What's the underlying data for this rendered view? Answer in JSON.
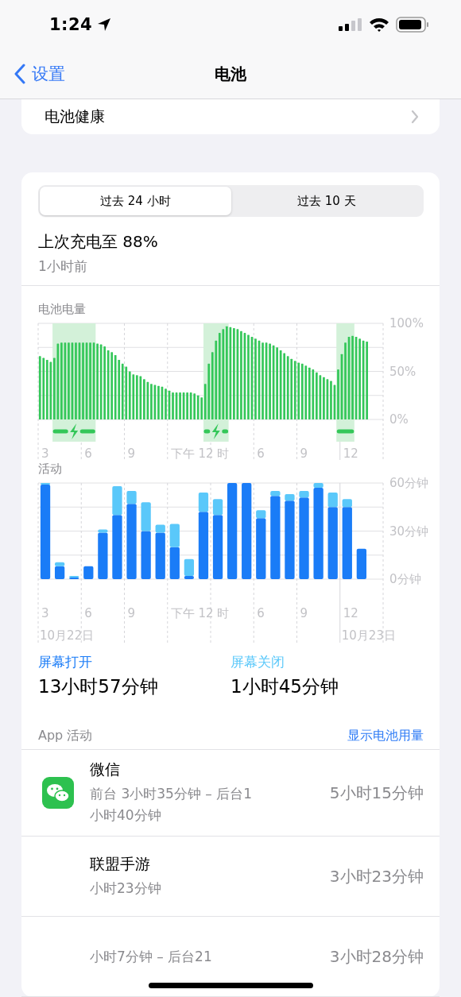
{
  "status_bar": {
    "time": "1:24"
  },
  "nav": {
    "back": "设置",
    "title": "电池"
  },
  "health_row": {
    "label": "电池健康"
  },
  "segments": [
    {
      "label": "过去 24 小时",
      "selected": true
    },
    {
      "label": "过去 10 天",
      "selected": false
    }
  ],
  "last_charge": {
    "title": "上次充电至 88%",
    "time": "1小时前"
  },
  "battery_level": {
    "chart_data": {
      "type": "bar",
      "title": "电池电量",
      "ylim": [
        0,
        100
      ],
      "yticks": [
        {
          "value": 0,
          "label": "0%"
        },
        {
          "value": 50,
          "label": "50%"
        },
        {
          "value": 100,
          "label": "100%"
        }
      ],
      "series": [
        {
          "color": "#34c759",
          "values": [
            66,
            64,
            62,
            60,
            64,
            79,
            80,
            80,
            80,
            80,
            80,
            80,
            80,
            80,
            80,
            80,
            79,
            78,
            76,
            72,
            70,
            67,
            62,
            58,
            55,
            50,
            47,
            46,
            45,
            42,
            39,
            37,
            36,
            35,
            34,
            32,
            30,
            28,
            28,
            28,
            28,
            28,
            28,
            27,
            25,
            23,
            37,
            58,
            70,
            82,
            90,
            94,
            97,
            96,
            95,
            94,
            92,
            90,
            88,
            86,
            84,
            82,
            80,
            80,
            79,
            77,
            75,
            72,
            69,
            66,
            63,
            61,
            59,
            58,
            56,
            54,
            52,
            49,
            46,
            44,
            42,
            40,
            36,
            52,
            68,
            80,
            86,
            87,
            86,
            84,
            82,
            81
          ]
        }
      ]
    },
    "x_labels": [
      "3",
      "6",
      "9",
      "下午 12 时",
      "6",
      "9",
      "12"
    ]
  },
  "activity": {
    "chart_data": {
      "type": "bar",
      "title": "活动",
      "stacked": true,
      "ylim": [
        0,
        60
      ],
      "yticks": [
        {
          "value": 0,
          "label": "0分钟"
        },
        {
          "value": 30,
          "label": "30分钟"
        },
        {
          "value": 60,
          "label": "60分钟"
        }
      ],
      "series": [
        {
          "name": "屏幕打开",
          "color": "#1a7cf7",
          "values": [
            59,
            8,
            1,
            8,
            29,
            40,
            47,
            30,
            29,
            20,
            2,
            42,
            40,
            60,
            60,
            38,
            52,
            49,
            51,
            57,
            45,
            45,
            19
          ]
        },
        {
          "name": "屏幕关闭",
          "color": "#5ac8fa",
          "values": [
            1,
            2.5,
            1,
            0,
            2,
            18,
            8,
            18,
            5,
            14.5,
            10.5,
            12,
            10,
            0,
            0,
            5,
            3,
            4,
            4,
            3,
            9,
            5,
            0
          ]
        }
      ]
    },
    "x_labels": [
      "3",
      "6",
      "9",
      "下午 12 时",
      "6",
      "9",
      "12"
    ],
    "dates": [
      "10月22日",
      "10月23日"
    ],
    "totals": [
      "13小时57分钟",
      "1小时45分钟"
    ]
  },
  "app_activity": {
    "title": "App 活动",
    "link": "显示电池用量",
    "apps": [
      {
        "name": "微信",
        "detail": "前台 3小时35分钟 – 后台1小时40分钟",
        "total": "5小时15分钟",
        "icon": true
      },
      {
        "name": "联盟手游",
        "detail": "小时23分钟",
        "total": "3小时23分钟",
        "icon": false
      },
      {
        "detail": "小时7分钟 – 后台21",
        "total": "3小时28分钟",
        "icon": false
      }
    ]
  }
}
